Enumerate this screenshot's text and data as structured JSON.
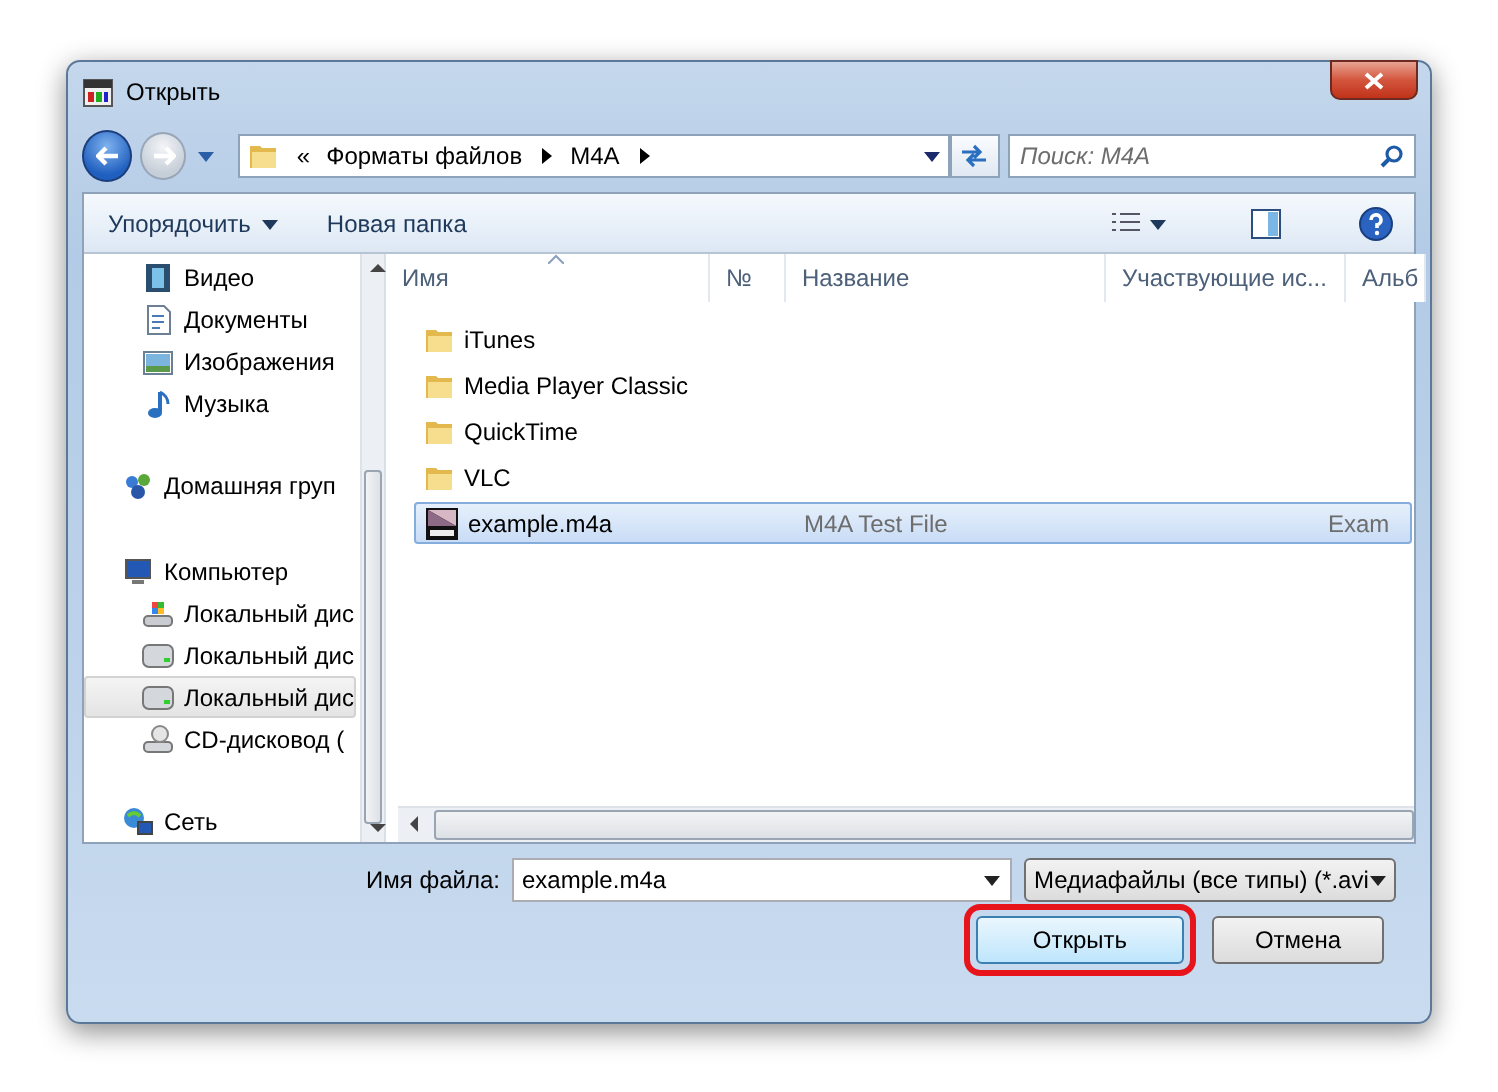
{
  "window": {
    "title": "Открыть"
  },
  "address": {
    "overflow_mark": "«",
    "path": [
      "Форматы файлов",
      "M4A"
    ]
  },
  "search": {
    "placeholder": "Поиск: M4A"
  },
  "toolbar": {
    "organize": "Упорядочить",
    "new_folder": "Новая папка"
  },
  "sidebar": [
    {
      "children": [
        {
          "label": "Видео",
          "kind": "video",
          "selected": false
        },
        {
          "label": "Документы",
          "kind": "documents",
          "selected": false
        },
        {
          "label": "Изображения",
          "kind": "images",
          "selected": false
        },
        {
          "label": "Музыка",
          "kind": "music",
          "selected": false
        }
      ]
    },
    {
      "label": "Домашняя груп",
      "kind": "homegroup",
      "selected": false
    },
    {
      "label": "Компьютер",
      "kind": "computer",
      "selected": false,
      "children": [
        {
          "label": "Локальный дис",
          "kind": "system-drive",
          "selected": false
        },
        {
          "label": "Локальный дис",
          "kind": "drive",
          "selected": false
        },
        {
          "label": "Локальный дис",
          "kind": "drive",
          "selected": true
        },
        {
          "label": "CD-дисковод (",
          "kind": "cd-drive",
          "selected": false
        }
      ]
    },
    {
      "label": "Сеть",
      "kind": "network",
      "selected": false
    }
  ],
  "columns": [
    {
      "label": "Имя",
      "sorted": true
    },
    {
      "label": "№",
      "sorted": false
    },
    {
      "label": "Название",
      "sorted": false
    },
    {
      "label": "Участвующие ис...",
      "sorted": false
    },
    {
      "label": "Альб",
      "sorted": false
    }
  ],
  "rows": [
    {
      "kind": "folder",
      "name": "iTunes",
      "selected": false
    },
    {
      "kind": "folder",
      "name": "Media Player Classic",
      "selected": false
    },
    {
      "kind": "folder",
      "name": "QuickTime",
      "selected": false
    },
    {
      "kind": "folder",
      "name": "VLC",
      "selected": false
    },
    {
      "kind": "audio",
      "name": "example.m4a",
      "title": "M4A Test File",
      "album": "Exam",
      "selected": true
    }
  ],
  "file_name": {
    "label": "Имя файла:",
    "value": "example.m4a"
  },
  "file_type": {
    "value": "Медиафайлы (все типы) (*.avi"
  },
  "buttons": [
    {
      "label": "Открыть",
      "default": true,
      "highlighted": true
    },
    {
      "label": "Отмена",
      "default": false,
      "highlighted": false
    }
  ]
}
